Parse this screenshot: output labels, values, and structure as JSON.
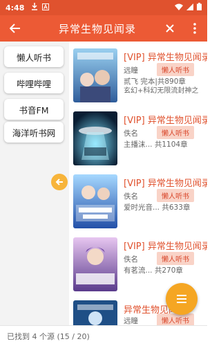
{
  "status": {
    "time": "4:48"
  },
  "toolbar": {
    "title": "异常生物见闻录"
  },
  "sources": [
    "懒人听书",
    "哔哩哔哩",
    "书音FM",
    "海洋听书网"
  ],
  "books": [
    {
      "title": "[VIP] 异常生物见闻录",
      "author": "远瞳",
      "tag": "懒人听书",
      "meta": "贰飞    完本|共890章",
      "desc": "玄幻+科幻无限流封神之作！普通人类与天外萌…"
    },
    {
      "title": "[VIP] 异常生物见闻录",
      "author": "佚名",
      "tag": "懒人听书",
      "meta": "主播沫...    共1104章",
      "desc": ""
    },
    {
      "title": "[VIP] 异常生物见闻录",
      "author": "佚名",
      "tag": "懒人听书",
      "meta": "爱时光音...    共633章",
      "desc": ""
    },
    {
      "title": "[VIP] 异常生物见闻录",
      "author": "佚名",
      "tag": "懒人听书",
      "meta": "有茗流...    共270章",
      "desc": ""
    },
    {
      "title": "异常生物见闻录",
      "author": "远瞳",
      "tag": "懒人听书",
      "meta": "",
      "desc": ""
    }
  ],
  "footer": {
    "text": "已找到 4 个源 (15 / 20)"
  }
}
